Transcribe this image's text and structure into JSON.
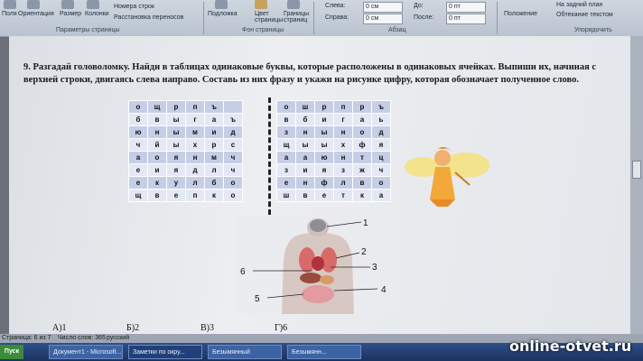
{
  "ribbon": {
    "buttons": [
      "Поля",
      "Ориентация",
      "Размер",
      "Колонки",
      "Номера строк",
      "Расстановка переносов",
      "Подложка",
      "Цвет страницы",
      "Границы страниц",
      "Слева:",
      "Справа:",
      "До:",
      "После:",
      "Положение",
      "На задний план",
      "Обтекание текстом"
    ],
    "indent_left": "0 см",
    "indent_right": "0 см",
    "spacing_before": "0 пт",
    "spacing_after": "0 пт",
    "groups": [
      "Параметры страницы",
      "Фон страницы",
      "Абзац",
      "Упорядочить"
    ]
  },
  "task": {
    "text": "9. Разгадай головоломку. Найди в таблицах одинаковые буквы, которые расположены в одинаковых ячейках. Выпиши их, начиная с верхней строки, двигаясь слева направо. Составь из них фразу и укажи на рисунке цифру, которая обозначает полученное слово."
  },
  "table_left": [
    [
      "о",
      "щ",
      "р",
      "п",
      "ъ"
    ],
    [
      "б",
      "в",
      "ы",
      "г",
      "а",
      "ъ"
    ],
    [
      "ю",
      "н",
      "ы",
      "м",
      "и",
      "д"
    ],
    [
      "ч",
      "й",
      "ы",
      "х",
      "р",
      "с"
    ],
    [
      "а",
      "о",
      "я",
      "н",
      "м",
      "ч"
    ],
    [
      "е",
      "и",
      "я",
      "д",
      "л",
      "ч"
    ],
    [
      "е",
      "к",
      "у",
      "л",
      "б",
      "о"
    ],
    [
      "щ",
      "в",
      "е",
      "п",
      "к",
      "о"
    ]
  ],
  "table_right": [
    [
      "о",
      "ш",
      "р",
      "п",
      "р",
      "ъ"
    ],
    [
      "в",
      "б",
      "и",
      "г",
      "а",
      "ь"
    ],
    [
      "з",
      "н",
      "ы",
      "н",
      "о",
      "д"
    ],
    [
      "щ",
      "ы",
      "ы",
      "х",
      "ф",
      "я"
    ],
    [
      "а",
      "а",
      "ю",
      "н",
      "т",
      "ц"
    ],
    [
      "з",
      "и",
      "я",
      "з",
      "ж",
      "ч"
    ],
    [
      "е",
      "н",
      "ф",
      "л",
      "в",
      "о"
    ],
    [
      "ш",
      "в",
      "е",
      "т",
      "к",
      "а"
    ]
  ],
  "figure_labels": [
    "1",
    "2",
    "3",
    "4",
    "5",
    "6"
  ],
  "answers": [
    "А)1",
    "Б)2",
    "В)3",
    "Г)6"
  ],
  "status": {
    "page": "Страница: 6 из 7",
    "words": "Число слов: 365",
    "language": "русский"
  },
  "taskbar": {
    "start": "Пуск",
    "items": [
      "Документ1 - Microsoft...",
      "Заметки по окру...",
      "Безымянный",
      "Безымянн..."
    ]
  },
  "watermark": "online-otvet.ru"
}
